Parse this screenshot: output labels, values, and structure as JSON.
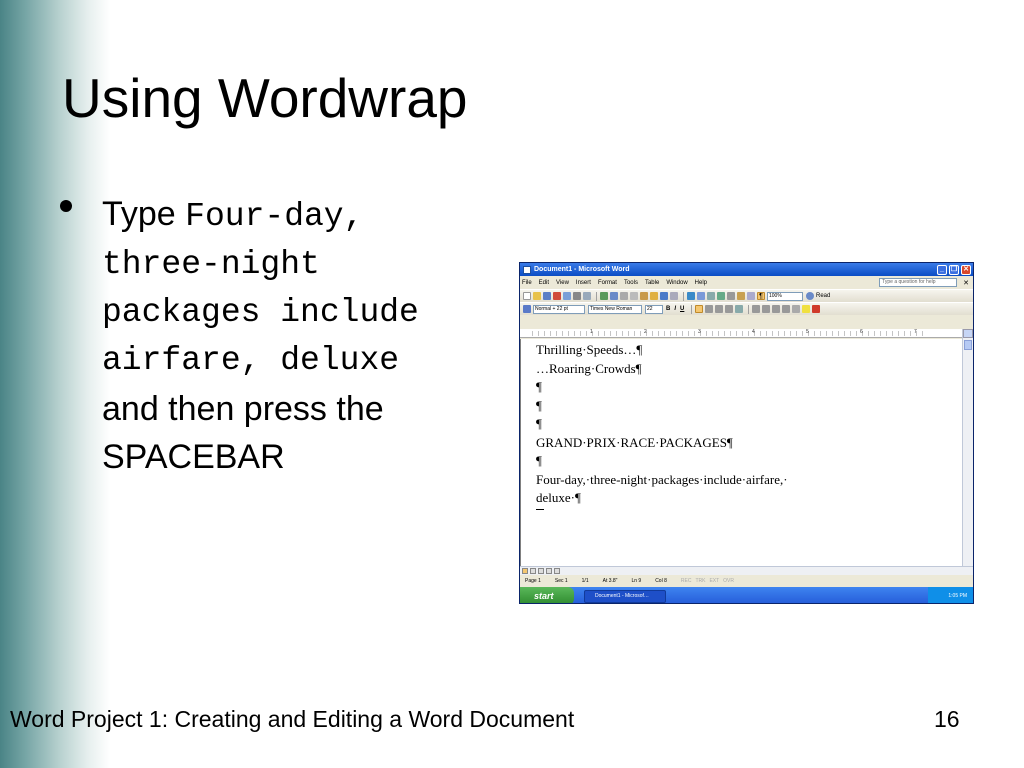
{
  "slide": {
    "title": "Using Wordwrap",
    "bullet": {
      "prefix": "Type",
      "code_lines": [
        "Four-day,",
        "three-night",
        "packages include",
        "airfare, deluxe"
      ],
      "suffix_lines": [
        "and then press the",
        "SPACEBAR"
      ]
    },
    "footer": "Word Project 1: Creating and Editing a Word Document",
    "page_number": "16"
  },
  "word": {
    "title": "Document1 - Microsoft Word",
    "menus": [
      "File",
      "Edit",
      "View",
      "Insert",
      "Format",
      "Tools",
      "Table",
      "Window",
      "Help"
    ],
    "help_placeholder": "Type a question for help",
    "zoom": "100%",
    "read_label": "Read",
    "style": "Normal + 22 pt",
    "font": "Times New Roman",
    "size": "22",
    "ruler_numbers": [
      "1",
      "2",
      "3",
      "4",
      "5",
      "6",
      "7"
    ],
    "document_lines": [
      "Thrilling·Speeds…¶",
      "…Roaring·Crowds¶",
      "¶",
      "¶",
      "¶",
      "GRAND·PRIX·RACE·PACKAGES¶",
      "¶",
      "Four-day,·three-night·packages·include·airfare,·",
      "deluxe·¶"
    ],
    "status": {
      "page": "Page 1",
      "sec": "Sec 1",
      "pages": "1/1",
      "at": "At 3.8\"",
      "ln": "Ln 9",
      "col": "Col 8",
      "modes": [
        "REC",
        "TRK",
        "EXT",
        "OVR"
      ]
    },
    "taskbar": {
      "start": "start",
      "task": "Document1 - Microsof…",
      "clock": "1:05 PM"
    }
  }
}
